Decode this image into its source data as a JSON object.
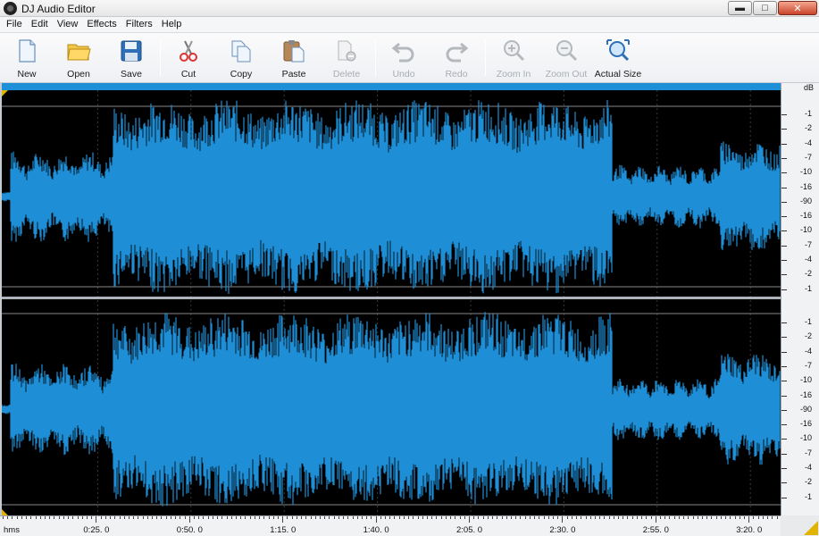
{
  "window": {
    "title": "DJ Audio Editor",
    "minimize": "▬",
    "maximize": "□",
    "close": "✕"
  },
  "menu": [
    "File",
    "Edit",
    "View",
    "Effects",
    "Filters",
    "Help"
  ],
  "toolbar": {
    "new": "New",
    "open": "Open",
    "save": "Save",
    "cut": "Cut",
    "copy": "Copy",
    "paste": "Paste",
    "delete": "Delete",
    "undo": "Undo",
    "redo": "Redo",
    "zoom_in": "Zoom In",
    "zoom_out": "Zoom Out",
    "actual_size": "Actual Size"
  },
  "ruler": {
    "unit": "dB",
    "top_ticks": [
      "-1",
      "-2",
      "-4",
      "-7",
      "-10",
      "-16",
      "-90",
      "-16",
      "-10",
      "-7",
      "-4",
      "-2",
      "-1"
    ],
    "bottom_ticks": [
      "-1",
      "-2",
      "-4",
      "-7",
      "-10",
      "-16",
      "-90",
      "-16",
      "-10",
      "-7",
      "-4",
      "-2",
      "-1"
    ]
  },
  "timeline": {
    "unit": "hms",
    "labels": [
      "0:25. 0",
      "0:50. 0",
      "1:15. 0",
      "1:40. 0",
      "2:05. 0",
      "2:30. 0",
      "2:55. 0",
      "3:20. 0"
    ]
  },
  "colors": {
    "waveform": "#1e8fd6",
    "background": "#000000",
    "progress": "#1e90d8"
  }
}
